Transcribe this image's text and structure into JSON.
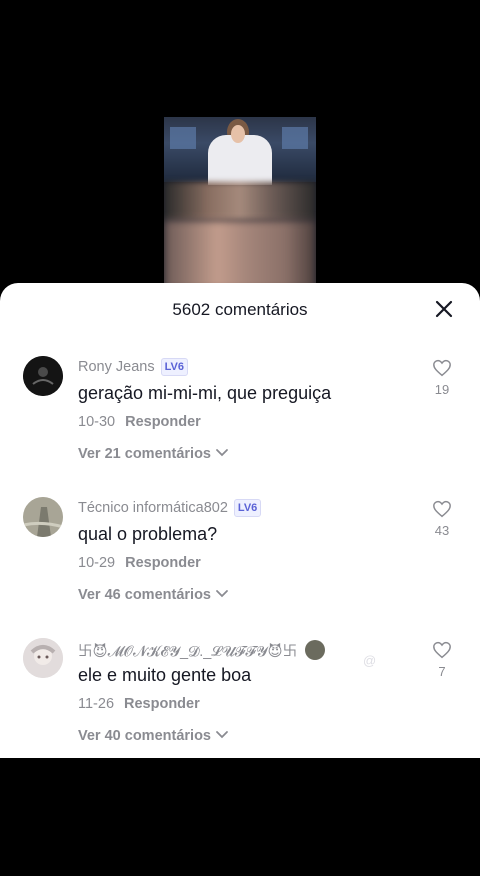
{
  "sheet": {
    "title": "5602 comentários"
  },
  "comments": [
    {
      "username": "Rony Jeans",
      "level": "LV6",
      "text": "geração mi-mi-mi, que preguiça",
      "date": "10-30",
      "reply_label": "Responder",
      "likes": "19",
      "view_replies": "Ver 21 comentários"
    },
    {
      "username": "Técnico informática802",
      "level": "LV6",
      "text": "qual o problema?",
      "date": "10-29",
      "reply_label": "Responder",
      "likes": "43",
      "view_replies": "Ver 46 comentários"
    },
    {
      "username": "卐😈𝓜𝓞𝓝𝓚𝓔𝓨_𝓓._𝓛𝓤𝓕𝓕𝓨😈卐",
      "text": "ele e muito gente boa",
      "date": "11-26",
      "reply_label": "Responder",
      "likes": "7",
      "view_replies": "Ver 40 comentários"
    }
  ],
  "watermark": "@",
  "colors": {
    "text_primary": "#161823",
    "text_secondary": "#8a8b91",
    "level_badge": "#5a62d6"
  },
  "icons": [
    "close-icon",
    "heart-outline-icon",
    "chevron-down-icon"
  ]
}
